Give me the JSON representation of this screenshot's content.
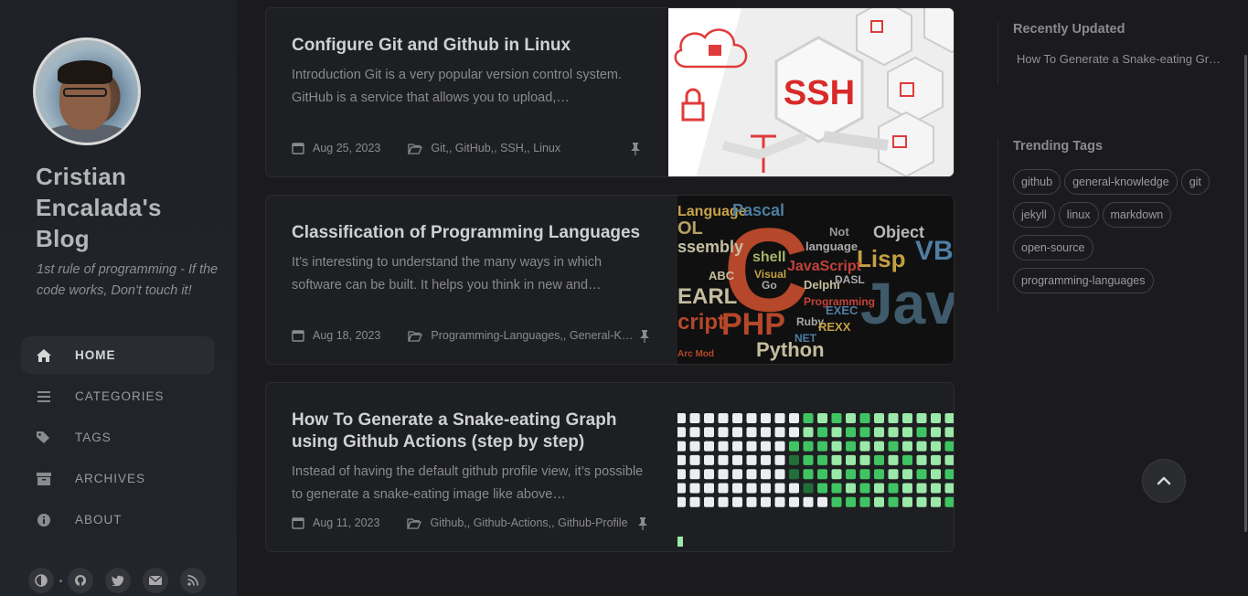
{
  "site": {
    "title": "Cristian Encalada's Blog",
    "subtitle": "1st rule of programming - If the code works, Don't touch it!"
  },
  "nav": [
    {
      "label": "HOME",
      "icon": "home-icon",
      "active": true
    },
    {
      "label": "CATEGORIES",
      "icon": "stream-icon",
      "active": false
    },
    {
      "label": "TAGS",
      "icon": "tags-icon",
      "active": false
    },
    {
      "label": "ARCHIVES",
      "icon": "archive-icon",
      "active": false
    },
    {
      "label": "ABOUT",
      "icon": "info-icon",
      "active": false
    }
  ],
  "social": [
    "theme-toggle-icon",
    "github-icon",
    "twitter-icon",
    "email-icon",
    "rss-icon"
  ],
  "posts": [
    {
      "title": "Configure Git and Github in Linux",
      "excerpt": "Introduction Git is a very popular version control system. GitHub is a service that allows you to upload,…",
      "date": "Aug 25, 2023",
      "categories": "Git,, GitHub,, SSH,, Linux",
      "image_text": "SSH"
    },
    {
      "title": "Classification of Programming Languages",
      "excerpt": "It’s interesting to understand the many ways in which software can be built. It helps you think in new and…",
      "date": "Aug 18, 2023",
      "categories": "Programming-Languages,, General-K…"
    },
    {
      "title": "How To Generate a Snake-eating Graph using Github Actions (step by step)",
      "excerpt": "Instead of having the default github profile view, it’s possible to generate a snake-eating image like above…",
      "date": "Aug 11, 2023",
      "categories": "Github,, Github-Actions,, Github-Profile"
    }
  ],
  "panel": {
    "recent_title": "Recently Updated",
    "recent_items": [
      "How To Generate a Snake-eating Gr…"
    ],
    "tags_title": "Trending Tags",
    "tags": [
      "github",
      "general-knowledge",
      "git",
      "jekyll",
      "linux",
      "markdown",
      "open-source",
      "programming-languages"
    ]
  },
  "colors": {
    "accent": "#cfd0d2",
    "background": "#1b1b1e",
    "card": "#1e1f22"
  }
}
